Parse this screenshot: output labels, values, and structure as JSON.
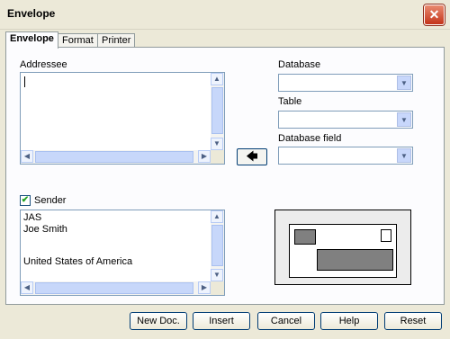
{
  "window": {
    "title": "Envelope",
    "close_glyph": "✕"
  },
  "tabs": [
    {
      "label": "Envelope",
      "active": true
    },
    {
      "label": "Format",
      "active": false
    },
    {
      "label": "Printer",
      "active": false
    }
  ],
  "addressee": {
    "label": "Addressee",
    "value": ""
  },
  "database": {
    "label": "Database",
    "value": ""
  },
  "table": {
    "label": "Table",
    "value": ""
  },
  "database_field": {
    "label": "Database field",
    "value": ""
  },
  "insert_arrow_glyph": "🡄",
  "sender": {
    "label": "Sender",
    "checked": true,
    "lines": [
      "JAS",
      "Joe Smith",
      "",
      "United States of America"
    ]
  },
  "buttons": {
    "new_doc": "New Doc.",
    "insert": "Insert",
    "cancel": "Cancel",
    "help": "Help",
    "reset": "Reset"
  },
  "scroll_glyphs": {
    "up": "▲",
    "down": "▼",
    "left": "◀",
    "right": "▶",
    "grip_v": "≡",
    "grip_h": "⋮⋮⋮",
    "dropdown": "▼"
  },
  "check_glyph": "✔"
}
